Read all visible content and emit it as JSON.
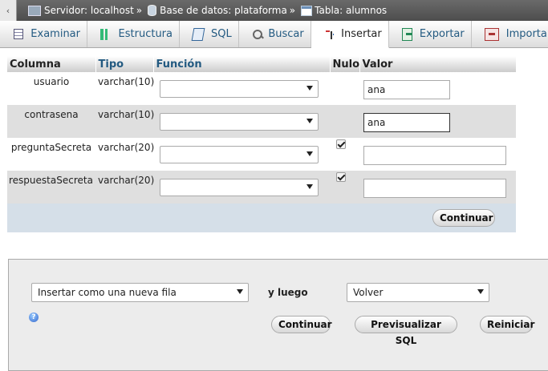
{
  "breadcrumb": {
    "back": "‹",
    "server_label": "Servidor: localhost",
    "database_label": "Base de datos: plataforma",
    "table_label": "Tabla: alumnos",
    "separator": "»"
  },
  "tabs": [
    {
      "label": "Examinar",
      "icon": "browse-icon"
    },
    {
      "label": "Estructura",
      "icon": "structure-icon"
    },
    {
      "label": "SQL",
      "icon": "sql-icon"
    },
    {
      "label": "Buscar",
      "icon": "search-icon"
    },
    {
      "label": "Insertar",
      "icon": "insert-icon",
      "active": true
    },
    {
      "label": "Exportar",
      "icon": "export-icon"
    },
    {
      "label": "Importar",
      "icon": "import-icon"
    }
  ],
  "table": {
    "headers": {
      "column": "Columna",
      "type": "Tipo",
      "function": "Función",
      "null": "Nulo",
      "value": "Valor"
    },
    "rows": [
      {
        "column": "usuario",
        "type": "varchar(10)",
        "value": "ana"
      },
      {
        "column": "contrasena",
        "type": "varchar(10)",
        "value": "ana"
      },
      {
        "column": "preguntaSecreta",
        "type": "varchar(20)",
        "value": ""
      },
      {
        "column": "respuestaSecreta",
        "type": "varchar(20)",
        "value": ""
      }
    ],
    "continue_label": "Continuar"
  },
  "bottom": {
    "insert_mode": "Insertar como una nueva fila",
    "then_label": "y luego",
    "after_action": "Volver",
    "help": "?",
    "continue_label": "Continuar",
    "preview_label": "Previsualizar SQL",
    "reset_label": "Reiniciar"
  },
  "colors": {
    "accent": "#235a81",
    "footer": "#d5dfe8",
    "row_even": "#dfdfdf"
  }
}
